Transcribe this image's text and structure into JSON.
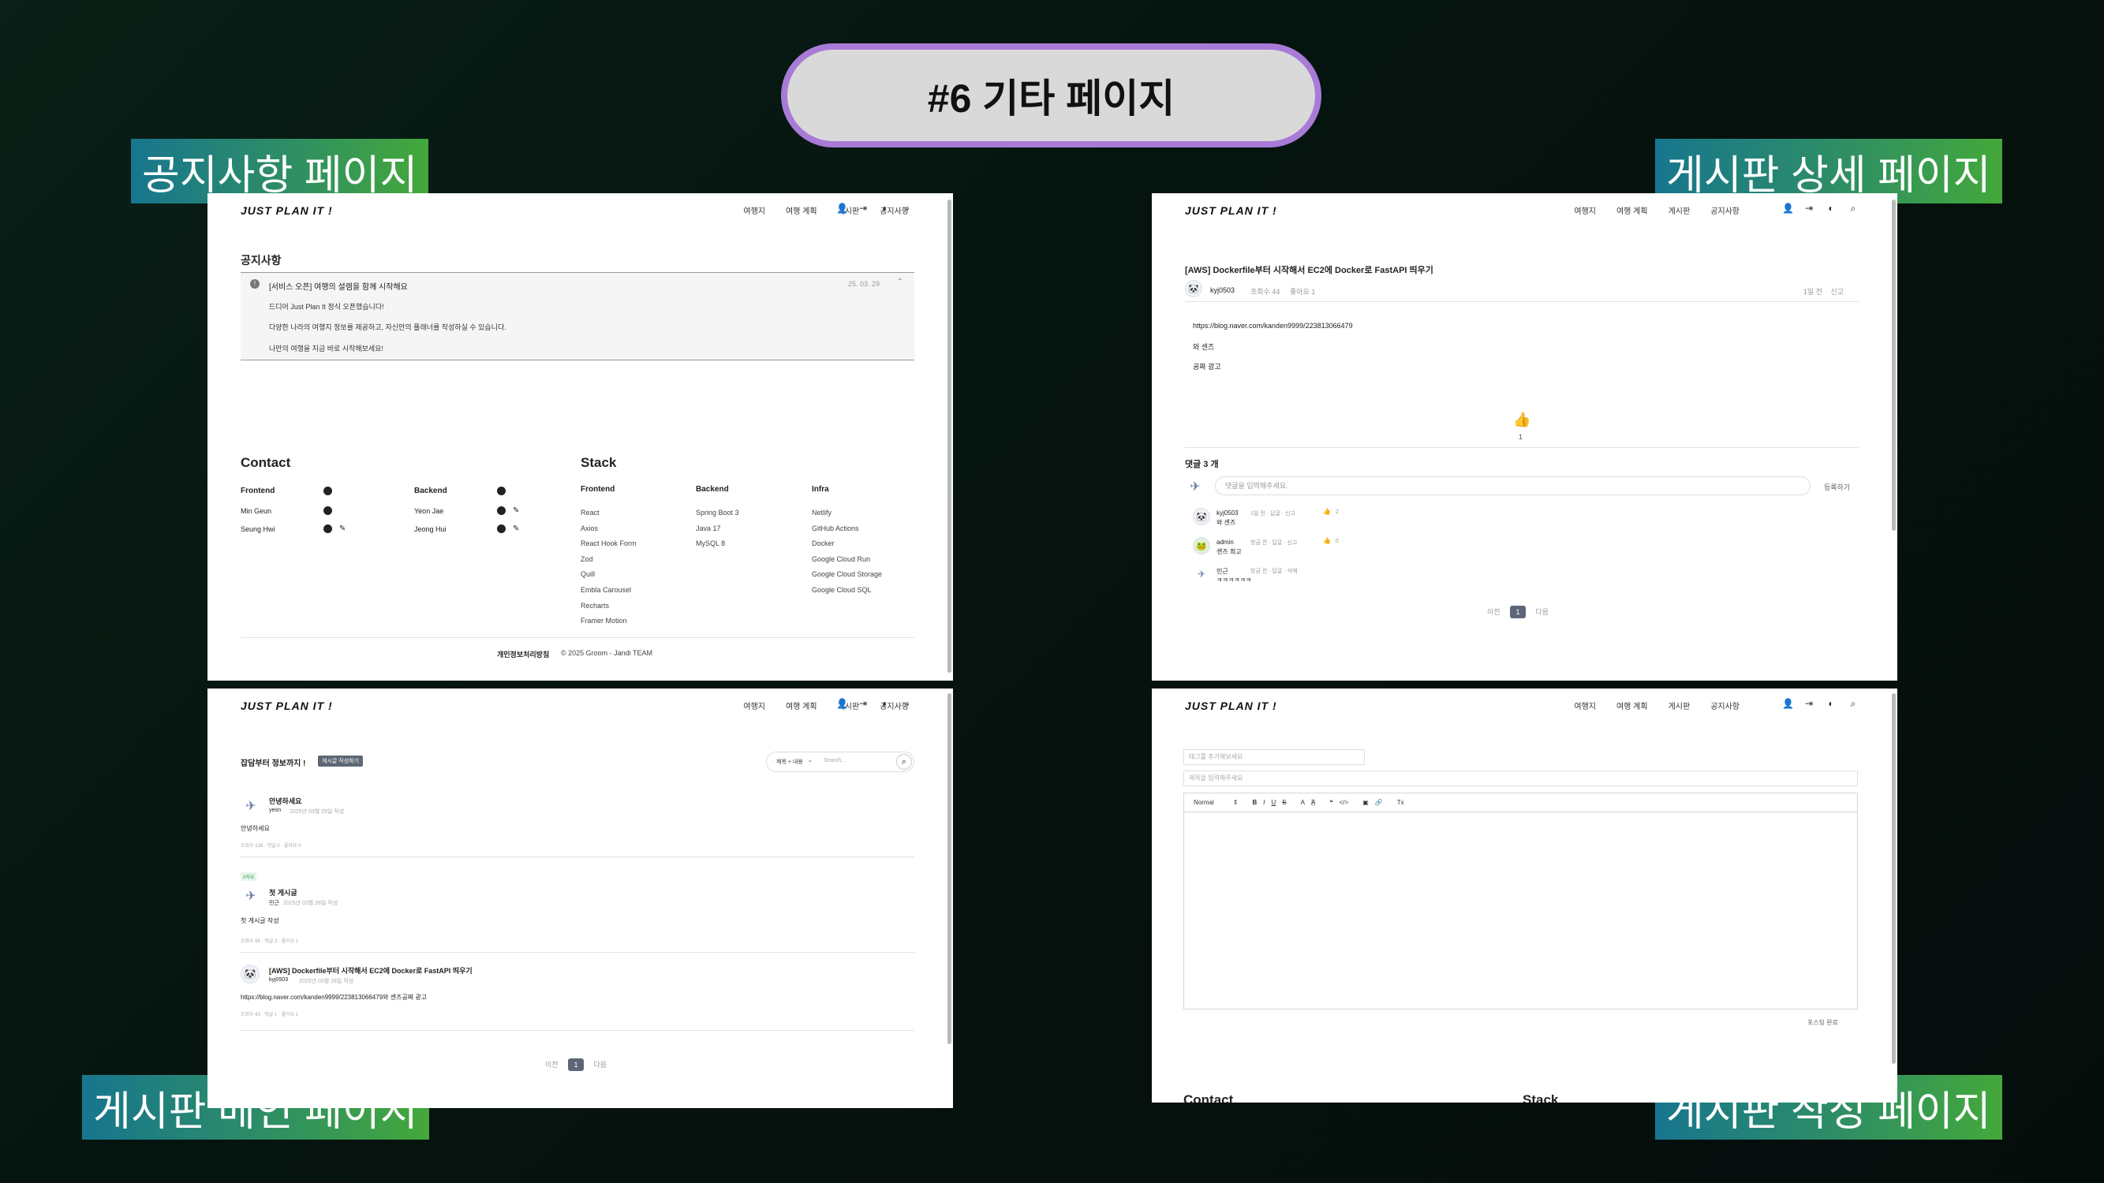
{
  "main_title": "#6 기타 페이지",
  "labels": {
    "notice": "공지사항 페이지",
    "detail": "게시판 상세 페이지",
    "board": "게시판 메인 페이지",
    "write": "게시판 작성 페이지"
  },
  "nav": {
    "logo": "JUST PLAN IT !",
    "items": [
      "여행지",
      "여행 계획",
      "게시판",
      "공지사항"
    ]
  },
  "notice": {
    "heading": "공지사항",
    "item_title": "[서비스 오픈] 여행의 설렘을 함께 시작해요",
    "item_date": "25. 03. 29",
    "body": [
      "드디어 Just Plan It 정식 오픈했습니다!",
      "다양한 나라의 여행지 정보를 제공하고, 자신만의 플래너를 작성하실 수 있습니다.",
      "나만의 여행을 지금 바로 시작해보세요!"
    ]
  },
  "footer": {
    "contact": "Contact",
    "stack": "Stack",
    "frontend": "Frontend",
    "backend": "Backend",
    "infra": "Infra",
    "fe_members": [
      "Min Geun",
      "Seung Hwi"
    ],
    "be_members": [
      "Yeon Jae",
      "Jeong Hui"
    ],
    "fe_stack": [
      "React",
      "Axios",
      "React Hook Form",
      "Zod",
      "Quill",
      "Embla Carousel",
      "Recharts",
      "Framer Motion"
    ],
    "be_stack": [
      "Spring Boot 3",
      "Java 17",
      "MySQL 8"
    ],
    "infra_stack": [
      "Netlify",
      "GitHub Actions",
      "Docker",
      "Google Cloud Run",
      "Google Cloud Storage",
      "Google Cloud SQL"
    ],
    "privacy": "개인정보처리방침",
    "copyright": "© 2025 Groom - Jandi TEAM"
  },
  "detail": {
    "title": "[AWS] Dockerfile부터 시작해서 EC2에 Docker로 FastAPI 띄우기",
    "author": "kyj0503",
    "meta": [
      "조회수 44",
      "좋아요 1"
    ],
    "right_meta": [
      "1일 전",
      "신고"
    ],
    "body": [
      "https://blog.naver.com/kanden9999/223813066479",
      "와 센즈",
      "공짜 광고"
    ],
    "likes": "1",
    "comments_title": "댓글 3 개",
    "comment_placeholder": "댓글을 입력해주세요.",
    "submit": "등록하기",
    "comments": [
      {
        "author": "kyj0503",
        "meta": "1일 전  ·  답글  ·  신고",
        "likes": "2",
        "text": "와 센즈"
      },
      {
        "author": "admin",
        "meta": "방금 전  ·  답글  ·  신고",
        "likes": "0",
        "text": "센즈 최고"
      },
      {
        "author": "민근",
        "meta": "방금 전  ·  답글  ·  삭제",
        "likes": "",
        "text": "ㅋㅋㅋㅋㅋㅋ"
      }
    ],
    "prev": "이전",
    "next": "다음",
    "page": "1"
  },
  "board": {
    "heading": "잡담부터 정보까지 !",
    "write_btn": "게시글 작성하기",
    "filter": "제목 + 내용",
    "search_placeholder": "Search...",
    "posts": [
      {
        "tag": "",
        "title": "안녕하세요",
        "author": "yeon",
        "date": "2025년 03월 29일 작성",
        "excerpt": "안녕하세요",
        "stats": "조회수 139  ·  댓글 0  ·  좋아요 0"
      },
      {
        "tag": "#자유",
        "title": "첫 게시글",
        "author": "민근",
        "date": "2025년 03월 28일 작성",
        "excerpt": "첫 게시글 작성",
        "stats": "조회수 66  ·  댓글 2  ·  좋아요 1"
      },
      {
        "tag": "",
        "title": "[AWS] Dockerfile부터 시작해서 EC2에 Docker로 FastAPI 띄우기",
        "author": "kyj0503",
        "date": "2025년 03월 28일 작성",
        "excerpt": "https://blog.naver.com/kanden9999/223813066479와 센즈공짜 광고",
        "stats": "조회수 43  ·  댓글 1  ·  좋아요 1"
      }
    ],
    "prev": "이전",
    "next": "다음",
    "page": "1"
  },
  "write": {
    "tag_placeholder": "태그를 추가해보세요",
    "title_placeholder": "제목을 입력해주세요",
    "format": "Normal",
    "toolbar": [
      "B",
      "I",
      "U",
      "S",
      "A",
      "A",
      "❝",
      "</>",
      "▣",
      "🔗",
      "Tx"
    ],
    "submit": "포스팅 완료",
    "contact": "Contact",
    "stack": "Stack"
  }
}
